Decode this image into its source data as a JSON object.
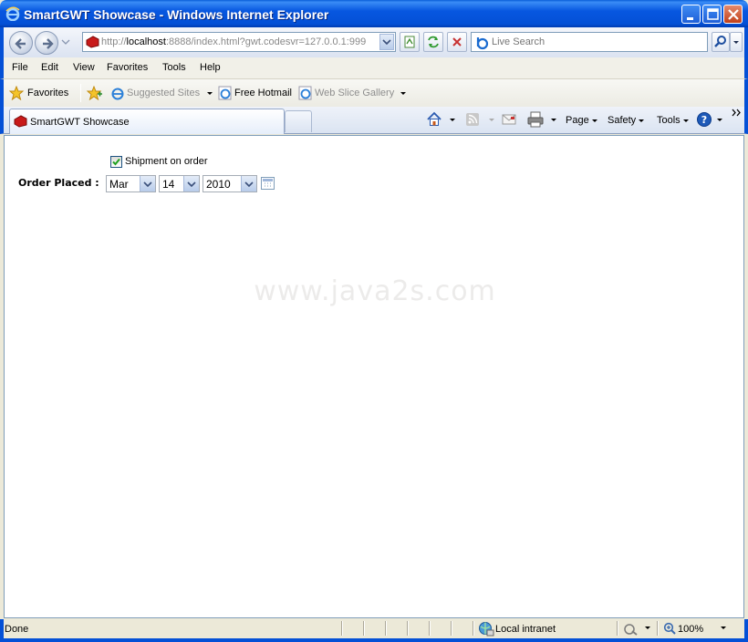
{
  "window": {
    "title": "SmartGWT Showcase - Windows Internet Explorer"
  },
  "address": {
    "prefix": "http://",
    "host": "localhost",
    "rest": ":8888/index.html?gwt.codesvr=127.0.0.1:999"
  },
  "search": {
    "placeholder": "Live Search"
  },
  "menu": [
    "File",
    "Edit",
    "View",
    "Favorites",
    "Tools",
    "Help"
  ],
  "favorites": {
    "label": "Favorites",
    "items": [
      "Suggested Sites",
      "Free Hotmail",
      "Web Slice Gallery"
    ]
  },
  "tab": {
    "label": "SmartGWT Showcase"
  },
  "commands": {
    "page": "Page",
    "safety": "Safety",
    "tools": "Tools"
  },
  "form": {
    "checkbox_label": "Shipment on order",
    "checkbox_checked": true,
    "date_label": "Order Placed :",
    "month": "Mar",
    "day": "14",
    "year": "2010"
  },
  "watermark": "www.java2s.com",
  "status": {
    "text": "Done",
    "zone": "Local intranet",
    "zoom": "100%"
  }
}
